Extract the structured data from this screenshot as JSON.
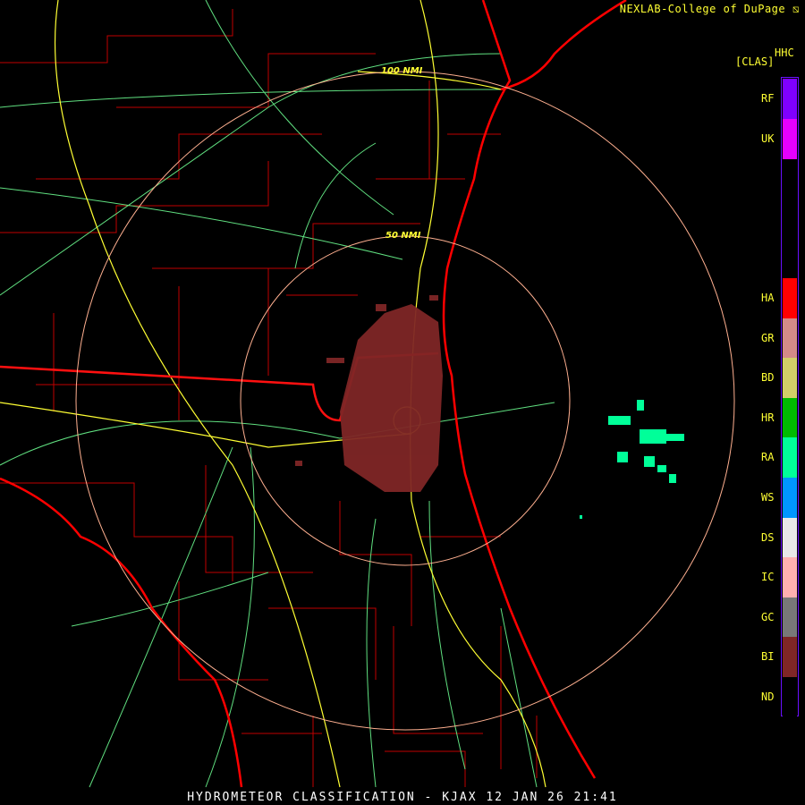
{
  "credit": "NEXLAB-College of DuPage",
  "product_code": "HHC",
  "product_type": "[CLAS]",
  "title": "HYDROMETEOR CLASSIFICATION - KJAX 12 JAN 26 21:41",
  "range_rings": [
    "50 NMI",
    "100 NMI"
  ],
  "legend": [
    {
      "code": "RF",
      "color": "#7f00ff",
      "slot": 0
    },
    {
      "code": "UK",
      "color": "#e600ff",
      "slot": 1
    },
    {
      "code": "HA",
      "color": "#ff0000",
      "slot": 5
    },
    {
      "code": "GR",
      "color": "#d48a88",
      "slot": 6
    },
    {
      "code": "BD",
      "color": "#d2cf68",
      "slot": 7
    },
    {
      "code": "HR",
      "color": "#00bb00",
      "slot": 8
    },
    {
      "code": "RA",
      "color": "#00ff99",
      "slot": 9
    },
    {
      "code": "WS",
      "color": "#0096ff",
      "slot": 10
    },
    {
      "code": "DS",
      "color": "#e8e8e8",
      "slot": 11
    },
    {
      "code": "IC",
      "color": "#ffb0b0",
      "slot": 12
    },
    {
      "code": "GC",
      "color": "#787878",
      "slot": 13
    },
    {
      "code": "BI",
      "color": "#7f2626",
      "slot": 14
    },
    {
      "code": "ND",
      "color": "#000000",
      "slot": 15
    }
  ]
}
